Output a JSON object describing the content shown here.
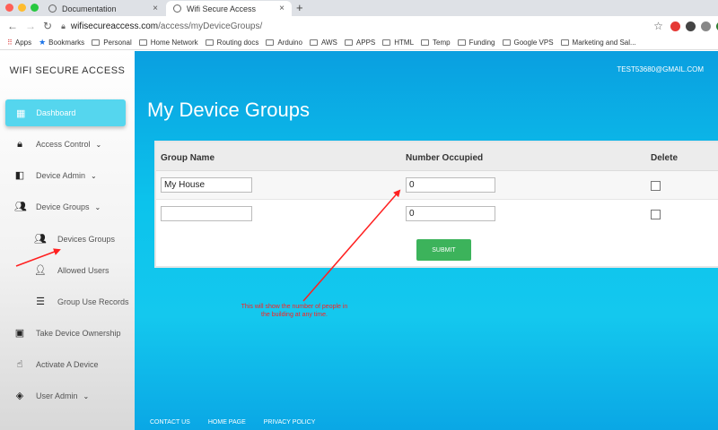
{
  "browser": {
    "tabs": [
      {
        "label": "Documentation",
        "active": false
      },
      {
        "label": "Wifi Secure Access",
        "active": true
      }
    ],
    "url_host": "wifisecureaccess.com",
    "url_path": "/access/myDeviceGroups/",
    "bookmarks": [
      "Apps",
      "Bookmarks",
      "Personal",
      "Home Network",
      "Routing docs",
      "Arduino",
      "AWS",
      "APPS",
      "HTML",
      "Temp",
      "Funding",
      "Google VPS",
      "Marketing and Sal..."
    ]
  },
  "sidebar": {
    "brand": "WIFI SECURE ACCESS",
    "items": [
      {
        "label": "Dashboard",
        "icon": "dashboard-icon",
        "active": true
      },
      {
        "label": "Access Control",
        "icon": "lock-icon",
        "chevron": true
      },
      {
        "label": "Device Admin",
        "icon": "device-icon",
        "chevron": true
      },
      {
        "label": "Device Groups",
        "icon": "group-icon",
        "chevron": true
      },
      {
        "label": "Devices Groups",
        "icon": "group-icon"
      },
      {
        "label": "Allowed Users",
        "icon": "person-icon"
      },
      {
        "label": "Group Use Records",
        "icon": "database-icon"
      },
      {
        "label": "Take Device Ownership",
        "icon": "ownership-icon"
      },
      {
        "label": "Activate A Device",
        "icon": "touch-icon"
      },
      {
        "label": "User Admin",
        "icon": "user-admin-icon",
        "chevron": true
      }
    ]
  },
  "header": {
    "user_email": "TEST53680@GMAIL.COM"
  },
  "main": {
    "title": "My Device Groups",
    "columns": [
      "Group Name",
      "Number Occupied",
      "Delete"
    ],
    "rows": [
      {
        "group_name": "My House",
        "number_occupied": "0",
        "delete": false
      },
      {
        "group_name": "",
        "number_occupied": "0",
        "delete": false
      }
    ],
    "submit_label": "SUBMIT"
  },
  "annotation": {
    "text": "This will show the number of people in the building at any time."
  },
  "footer": {
    "links": [
      "CONTACT US",
      "HOME PAGE",
      "PRIVACY POLICY"
    ]
  },
  "colors": {
    "accent": "#55d6ee",
    "submit": "#3cb35b",
    "annotation": "#ff2020",
    "main_bg": "#0cc3ec"
  }
}
